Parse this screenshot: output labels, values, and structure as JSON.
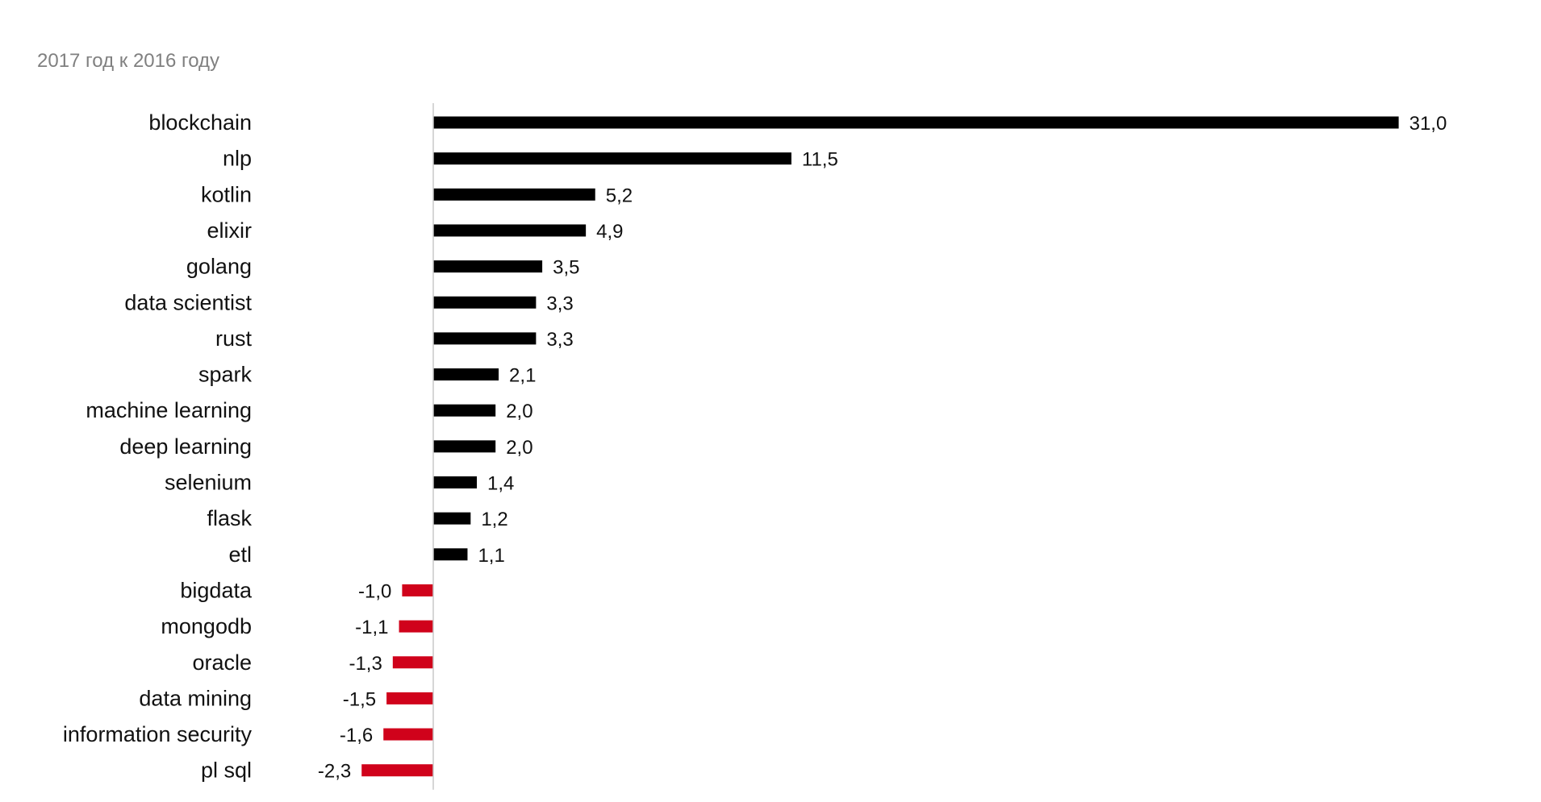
{
  "chart_data": {
    "type": "bar",
    "orientation": "horizontal",
    "title": "",
    "subtitle": "2017 год к 2016 году",
    "xlabel": "",
    "ylabel": "",
    "grid": false,
    "legend": "none",
    "xlim": [
      -3.5,
      31.0
    ],
    "categories": [
      "blockchain",
      "nlp",
      "kotlin",
      "elixir",
      "golang",
      "data scientist",
      "rust",
      "spark",
      "machine learning",
      "deep learning",
      "selenium",
      "flask",
      "etl",
      "bigdata",
      "mongodb",
      "oracle",
      "data mining",
      "information security",
      "pl sql"
    ],
    "values": [
      31.0,
      11.5,
      5.2,
      4.9,
      3.5,
      3.3,
      3.3,
      2.1,
      2.0,
      2.0,
      1.4,
      1.2,
      1.1,
      -1.0,
      -1.1,
      -1.3,
      -1.5,
      -1.6,
      -2.3
    ],
    "value_labels": [
      "31,0",
      "11,5",
      "5,2",
      "4,9",
      "3,5",
      "3,3",
      "3,3",
      "2,1",
      "2,0",
      "2,0",
      "1,4",
      "1,2",
      "1,1",
      "-1,0",
      "-1,1",
      "-1,3",
      "-1,5",
      "-1,6",
      "-2,3"
    ],
    "colors": {
      "positive": "#000000",
      "negative": "#d0021b",
      "axis": "#c8c8c8"
    }
  }
}
